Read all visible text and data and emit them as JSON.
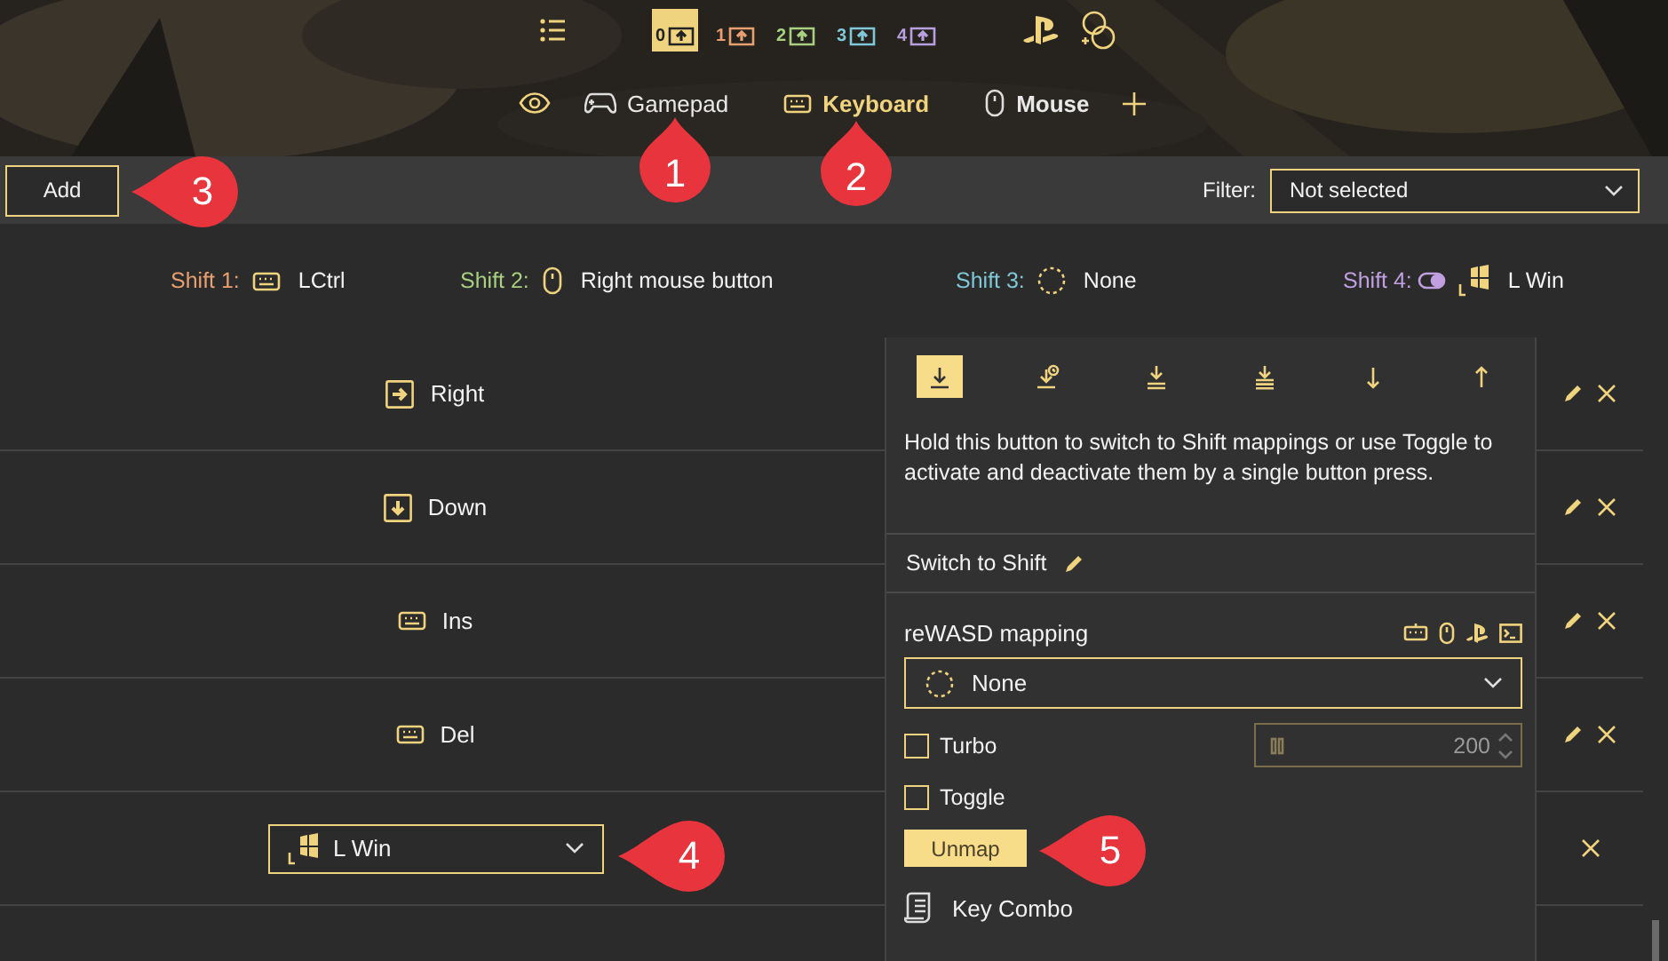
{
  "shift_layers": [
    {
      "label": "0",
      "selected": true,
      "color": "#f0d37e"
    },
    {
      "label": "1",
      "selected": false,
      "color": "#e8a070"
    },
    {
      "label": "2",
      "selected": false,
      "color": "#a8d080"
    },
    {
      "label": "3",
      "selected": false,
      "color": "#80c8d8"
    },
    {
      "label": "4",
      "selected": false,
      "color": "#b8a0e0"
    }
  ],
  "device_tabs": [
    {
      "kind": "gamepad",
      "label": "Gamepad",
      "selected": false,
      "bold": false
    },
    {
      "kind": "keyboard",
      "label": "Keyboard",
      "selected": true,
      "bold": true
    },
    {
      "kind": "mouse",
      "label": "Mouse",
      "selected": false,
      "bold": true
    }
  ],
  "toolbar": {
    "add_button": "Add",
    "filter_label": "Filter:",
    "filter_value": "Not selected"
  },
  "shifts": [
    {
      "label": "Shift 1:",
      "color": "#e8a070",
      "kind": "keyboard",
      "toggle": false,
      "value": "LCtrl"
    },
    {
      "label": "Shift 2:",
      "color": "#a8d080",
      "kind": "mouse",
      "toggle": false,
      "value": "Right mouse button"
    },
    {
      "label": "Shift 3:",
      "color": "#80c8d8",
      "kind": "none",
      "toggle": false,
      "value": "None"
    },
    {
      "label": "Shift 4:",
      "color": "#c0a0e0",
      "kind": "windows",
      "toggle": true,
      "value": "L Win"
    }
  ],
  "mappings": [
    {
      "kind": "arrow-right",
      "label": "Right",
      "editable": true
    },
    {
      "kind": "arrow-down",
      "label": "Down",
      "editable": true
    },
    {
      "kind": "keyboard",
      "label": "Ins",
      "editable": true
    },
    {
      "kind": "keyboard",
      "label": "Del",
      "editable": true
    },
    {
      "kind": "dropdown",
      "label": "L Win",
      "editable": false
    }
  ],
  "panel": {
    "activators": [
      {
        "kind": "single",
        "selected": true
      },
      {
        "kind": "long",
        "selected": false
      },
      {
        "kind": "double",
        "selected": false
      },
      {
        "kind": "triple",
        "selected": false
      },
      {
        "kind": "down",
        "selected": false
      },
      {
        "kind": "up",
        "selected": false
      }
    ],
    "description": "Hold this button to switch to Shift mappings or use Toggle to activate and deactivate them by a single button press.",
    "name": "Switch to Shift",
    "mapping_title": "reWASD mapping",
    "mapping_value": "None",
    "options": [
      {
        "label": "Turbo",
        "checked": false
      },
      {
        "label": "Toggle",
        "checked": false
      }
    ],
    "turbo_value": "200",
    "unmap_button": "Unmap",
    "key_combo": "Key Combo"
  },
  "callouts": [
    {
      "label": "3"
    },
    {
      "label": "1"
    },
    {
      "label": "2"
    },
    {
      "label": "4"
    },
    {
      "label": "5"
    }
  ]
}
